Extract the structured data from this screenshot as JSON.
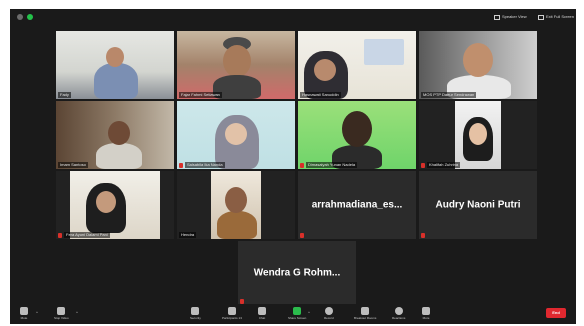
{
  "window": {
    "speaker_view_label": "Speaker View",
    "exit_full_screen_label": "Exit Full Screen"
  },
  "participants": [
    {
      "id": "tile-1",
      "name": "Fady",
      "muted": false,
      "video": true
    },
    {
      "id": "tile-2",
      "name": "Fajar Fahmi Setiawan",
      "muted": false,
      "video": true
    },
    {
      "id": "tile-3",
      "name": "Hasnawati Sanuddin",
      "muted": false,
      "video": true
    },
    {
      "id": "tile-4",
      "name": "MOS PTP Daeur Sendrawan",
      "muted": false,
      "video": true
    },
    {
      "id": "tile-5",
      "name": "Imam Santoso",
      "muted": false,
      "video": true,
      "active_speaker": true
    },
    {
      "id": "tile-6",
      "name": "Salsabila Ika Nanda",
      "muted": true,
      "video": true
    },
    {
      "id": "tile-7",
      "name": "Dimasalyah Yunan Nadela",
      "muted": true,
      "video": true
    },
    {
      "id": "tile-8",
      "name": "Khalifah Zuhrina",
      "muted": true,
      "video": true
    },
    {
      "id": "tile-9",
      "name": "Fera Ayuni Dalami Pani",
      "muted": true,
      "video": true
    },
    {
      "id": "tile-10",
      "name": "Hendra",
      "muted": false,
      "video": true
    },
    {
      "id": "tile-11",
      "name": "arrahmadiana_es...",
      "muted": true,
      "video": false
    },
    {
      "id": "tile-12",
      "name": "Audry Naoni Putri",
      "muted": true,
      "video": false
    },
    {
      "id": "tile-13",
      "name": "Wendra G Rohm...",
      "muted": true,
      "video": false
    }
  ],
  "toolbar": {
    "mute": "Mute",
    "stop_video": "Stop Video",
    "security": "Security",
    "participants": "Participants",
    "participants_count": "13",
    "chat": "Chat",
    "share_screen": "Share Screen",
    "record": "Record",
    "breakout_rooms": "Breakout Rooms",
    "reactions": "Reactions",
    "more": "More",
    "end": "End"
  },
  "colors": {
    "background": "#1a1a1a",
    "tile": "#2b2b2b",
    "active_border": "#d2c23d",
    "end_button": "#e0282f",
    "share_green": "#2bbb4c",
    "muted_red": "#d8302a"
  }
}
